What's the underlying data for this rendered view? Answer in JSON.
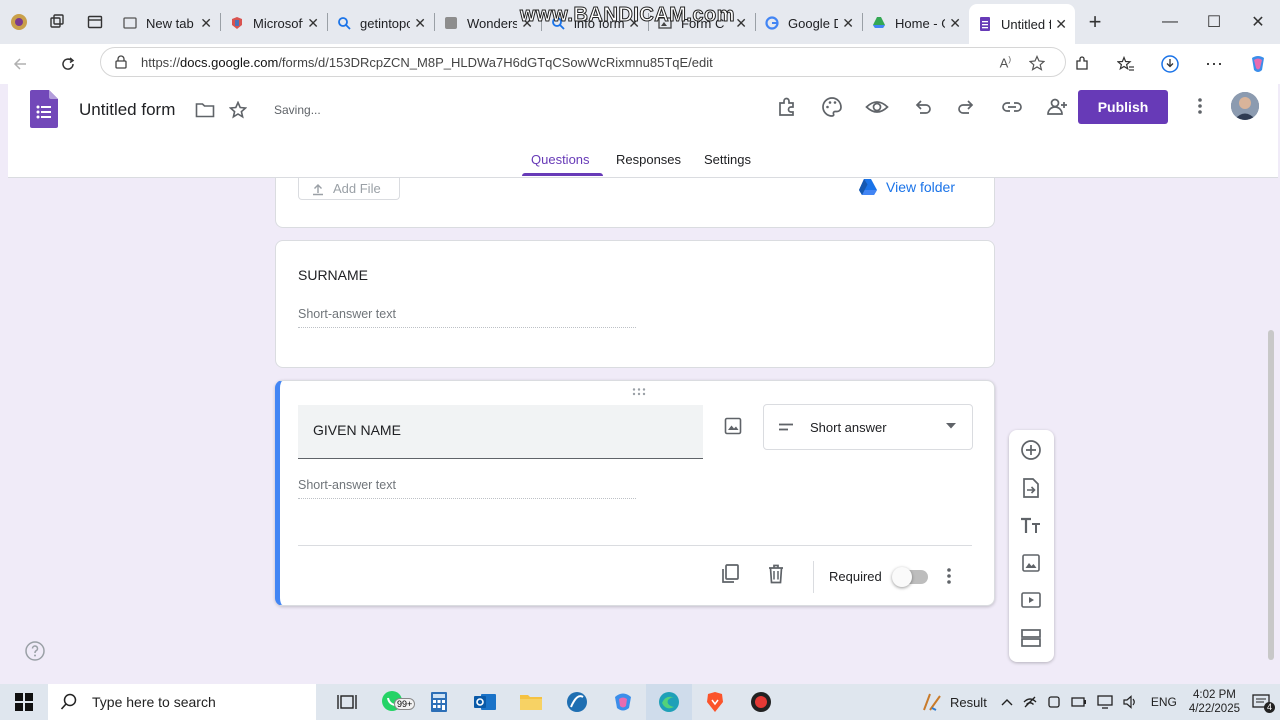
{
  "browser": {
    "tabs": [
      {
        "title": "",
        "icon": "profile-icon"
      },
      {
        "title": "New tab",
        "icon": "newtab-icon"
      },
      {
        "title": "Microsoft",
        "icon": "microsoft-icon"
      },
      {
        "title": "getintopc",
        "icon": "search-icon"
      },
      {
        "title": "Wonders",
        "icon": "page-icon"
      },
      {
        "title": "info form",
        "icon": "search-icon"
      },
      {
        "title": "Form C",
        "icon": "image-icon"
      },
      {
        "title": "Google D",
        "icon": "google-icon"
      },
      {
        "title": "Home - G",
        "icon": "drive-icon"
      },
      {
        "title": "Untitled f",
        "icon": "forms-icon",
        "active": true
      }
    ],
    "url": "https://docs.google.com/forms/d/153DRcpZCN_M8P_HLDWa7H6dGTqCSowWcRixmnu85TqE/edit",
    "url_host": "docs.google.com",
    "url_prefix": "https://",
    "url_path": "/forms/d/153DRcpZCN_M8P_HLDWa7H6dGTqCSowWcRixmnu85TqE/edit",
    "watermark": "www.BANDICAM.com"
  },
  "forms": {
    "title": "Untitled form",
    "status": "Saving...",
    "publish_label": "Publish",
    "tabs": {
      "questions": "Questions",
      "responses": "Responses",
      "settings": "Settings"
    },
    "accent_color": "#673ab7",
    "cards": {
      "upload": {
        "add_file": "Add File",
        "view_folder": "View folder"
      },
      "surname": {
        "title": "SURNAME",
        "placeholder": "Short-answer text"
      },
      "given_name": {
        "title": "GIVEN NAME",
        "placeholder": "Short-answer text",
        "type": "Short answer",
        "required_label": "Required",
        "required": false
      }
    }
  },
  "taskbar": {
    "search_placeholder": "Type here to search",
    "badge": "99+",
    "result_label": "Result",
    "lang": "ENG",
    "time": "4:02 PM",
    "date": "4/22/2025",
    "notifications": "4"
  }
}
